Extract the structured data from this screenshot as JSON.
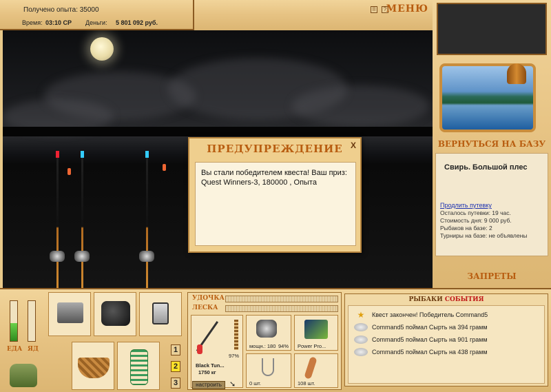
{
  "hud": {
    "exp_label": "Получено опыта: 35000",
    "time_label": "Время:",
    "time_value": "03:10 СР",
    "money_label": "Деньги:",
    "money_value": "5 801 092 руб.",
    "pause_glyph": "II",
    "help_glyph": "?",
    "menu_label": "МЕНЮ"
  },
  "dialog": {
    "title": "ПРЕДУПРЕЖДЕНИЕ",
    "close_glyph": "X",
    "message": "Вы стали победителем квеста! Ваш приз: Quest Winners-3, 180000 , Опыта"
  },
  "right": {
    "back_to_base": "ВЕРНУТЬСЯ НА БАЗУ",
    "place": "Свирь. Большой плес",
    "extend_link": "Продлить путевку",
    "lines": [
      "Осталось путевки: 19 час.",
      "Стоимость дня: 9 000 руб.",
      "Рыбаков на базе: 2",
      "Турниры на базе: не объявлены"
    ],
    "bans": "ЗАПРЕТЫ"
  },
  "bottom": {
    "food_label": "ЕДА",
    "poison_label": "ЯД",
    "food_level": 0.45,
    "poison_level": 0.0,
    "slot_numbers": [
      "1",
      "2",
      "3"
    ],
    "active_slot": "2",
    "rod_label": "УДОЧКА",
    "line_label": "ЛЕСКА",
    "rod_name": "Black Tun...",
    "rod_weight": "1750 кг",
    "rod_pct": "97%",
    "reel_power": "мощн.: 180",
    "reel_pct": "94%",
    "line_name": "Power Pro...",
    "hook_count": "0 шт.",
    "bait_count": "108 шт.",
    "tune_button": "настроить"
  },
  "events": {
    "title_part1": "РЫБАКИ",
    "title_part2": "СОБЫТИЯ",
    "items": [
      "Квест закончен! Победитель Command5",
      "Command5 поймал Сырть на 394 грамм",
      "Command5 поймал Сырть на 901 грамм",
      "Command5 поймал Сырть на 438 грамм"
    ]
  },
  "colors": {
    "accent": "#b85d10",
    "wood": "#e6c282",
    "sky": "#1c1d20"
  }
}
